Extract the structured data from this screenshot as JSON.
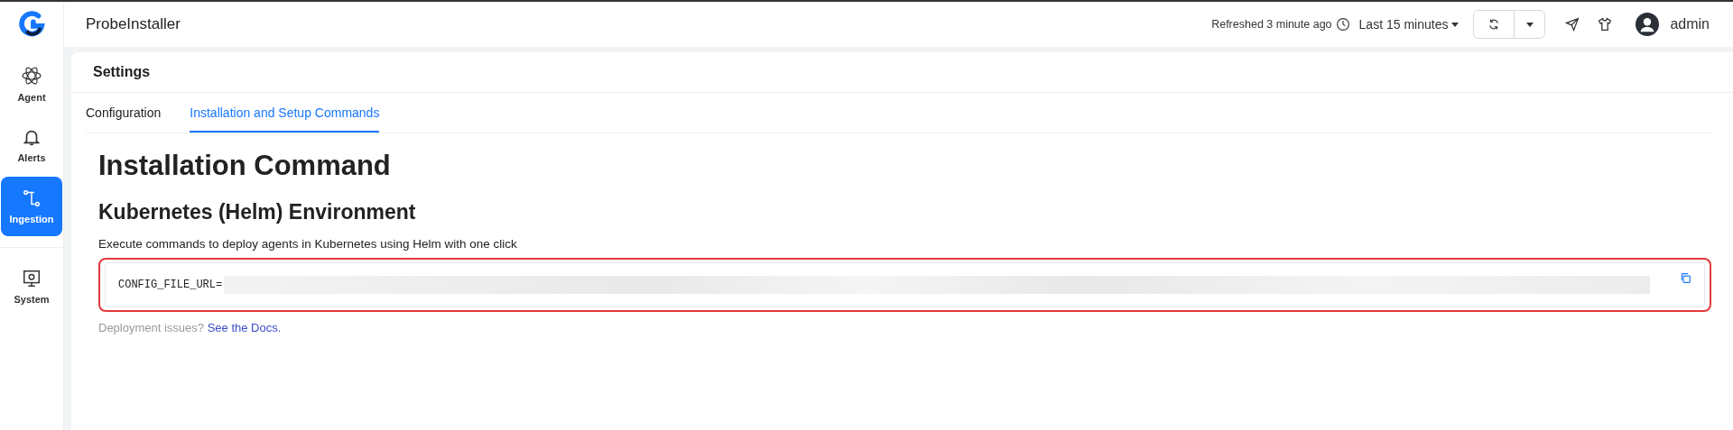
{
  "sidebar": {
    "items": [
      {
        "label": "Agent",
        "selected": false
      },
      {
        "label": "Alerts",
        "selected": false
      },
      {
        "label": "Ingestion",
        "selected": true
      },
      {
        "label": "System",
        "selected": false
      }
    ]
  },
  "header": {
    "title": "ProbeInstaller",
    "refreshed": "Refreshed 3 minute ago",
    "time_range": "Last 15 minutes",
    "user": "admin"
  },
  "page": {
    "title": "Settings",
    "tabs": [
      {
        "label": "Configuration",
        "selected": false
      },
      {
        "label": "Installation and Setup Commands",
        "selected": true
      }
    ],
    "heading": "Installation Command",
    "subheading": "Kubernetes (Helm) Environment",
    "description": "Execute commands to deploy agents in Kubernetes using Helm with one click",
    "command": "CONFIG_FILE_URL=",
    "help_text": "Deployment issues?",
    "help_link": "See the Docs."
  }
}
